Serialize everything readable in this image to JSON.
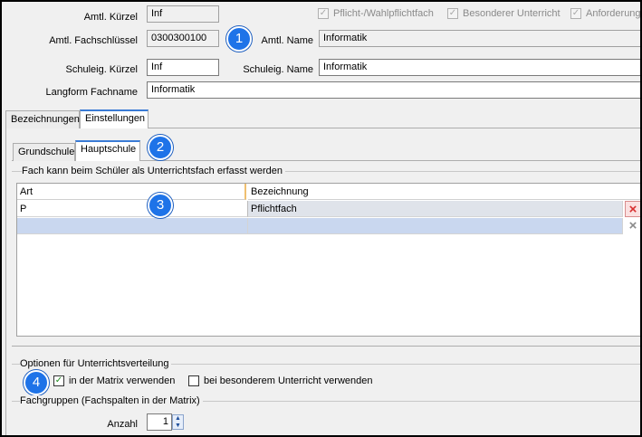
{
  "header": {
    "amtl_kuerzel_label": "Amtl. Kürzel",
    "amtl_kuerzel_value": "Inf",
    "amtl_fachschluessel_label": "Amtl. Fachschlüssel",
    "amtl_fachschluessel_value": "0300300100",
    "amtl_name_label": "Amtl. Name",
    "amtl_name_value": "Informatik",
    "schuleig_kuerzel_label": "Schuleig. Kürzel",
    "schuleig_kuerzel_value": "Inf",
    "schuleig_name_label": "Schuleig. Name",
    "schuleig_name_value": "Informatik",
    "langform_label": "Langform Fachname",
    "langform_value": "Informatik",
    "checkboxes": {
      "pflicht": "Pflicht-/Wahlpflichtfach",
      "besonderer": "Besonderer Unterricht",
      "anforderung": "Anforderung"
    }
  },
  "tabs": {
    "bezeichnungen": "Bezeichnungen",
    "einstellungen": "Einstellungen"
  },
  "subtabs": {
    "grundschule": "Grundschule",
    "hauptschule": "Hauptschule"
  },
  "fach_group": {
    "title": "Fach kann beim Schüler als Unterrichtsfach erfasst werden",
    "columns": [
      "Art",
      "Bezeichnung"
    ],
    "rows": [
      {
        "art": "P",
        "bezeichnung": "Pflichtfach"
      },
      {
        "art": "",
        "bezeichnung": ""
      }
    ]
  },
  "optionen": {
    "title": "Optionen für Unterrichtsverteilung",
    "matrix_label": "in der Matrix verwenden",
    "matrix_checked": true,
    "besonderer_label": "bei besonderem Unterricht verwenden",
    "besonderer_checked": false
  },
  "fachgruppen": {
    "title": "Fachgruppen (Fachspalten in der Matrix)",
    "anzahl_label": "Anzahl",
    "anzahl_value": "1"
  },
  "badges": [
    "1",
    "2",
    "3",
    "4"
  ],
  "colors": {
    "badge": "#1e73e8",
    "tab_accent": "#3a7bd5",
    "selected_row": "#dfe3ea",
    "new_row": "#c9d7ef",
    "delete_active": "#d83030"
  },
  "icons": {
    "delete_row": "×",
    "check": "✓",
    "spin_up": "▲",
    "spin_down": "▼"
  }
}
